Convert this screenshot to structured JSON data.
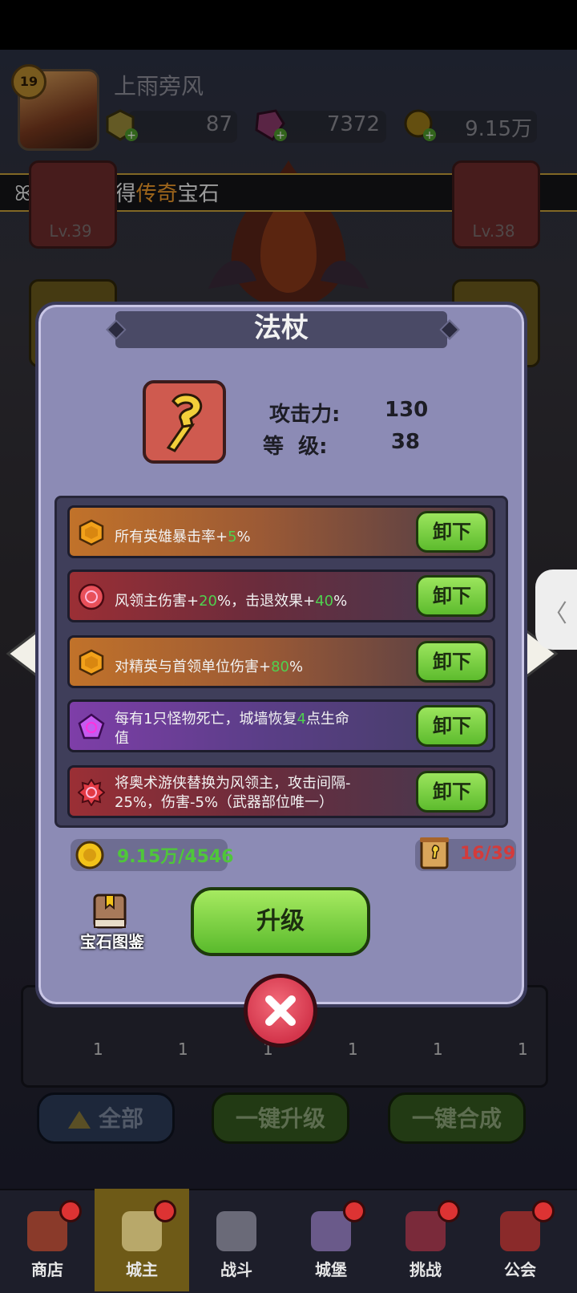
{
  "player": {
    "name": "上雨旁风",
    "level": "19",
    "resource_1": "87",
    "resource_2": "7372",
    "resource_3": "9.15万"
  },
  "banner": {
    "prefix": "宝箱中获得",
    "highlight": "传奇",
    "suffix": "宝石",
    "lead_glyph": "ꕤ"
  },
  "side_slots": {
    "left_level": "Lv.39",
    "right_level": "Lv.38"
  },
  "modal": {
    "title": "法杖",
    "stats": {
      "attack_label": "攻击力:",
      "attack_value": "130",
      "level_label": "等  级:",
      "level_value": "38"
    },
    "gems": [
      {
        "pre": "所有英雄暴击率+",
        "v1": "5",
        "mid": "%",
        "v2": "",
        "post": "",
        "line2": "",
        "kind": "orange",
        "button": "卸下"
      },
      {
        "pre": "风领主伤害+",
        "v1": "20",
        "mid": "%，击退效果+",
        "v2": "40",
        "post": "%",
        "line2": "",
        "kind": "red",
        "button": "卸下"
      },
      {
        "pre": "对精英与首领单位伤害+",
        "v1": "80",
        "mid": "%",
        "v2": "",
        "post": "",
        "line2": "",
        "kind": "orange",
        "button": "卸下"
      },
      {
        "pre": "每有1只怪物死亡，城墙恢复",
        "v1": "4",
        "mid": "点生命",
        "v2": "",
        "post": "",
        "line2": "值",
        "kind": "purple",
        "button": "卸下"
      },
      {
        "pre": "将奥术游侠替换为风领主，攻击间隔-",
        "v1": "",
        "mid": "",
        "v2": "",
        "post": "",
        "line2": "25%，伤害-5%（武器部位唯一）",
        "kind": "red",
        "button": "卸下"
      }
    ],
    "gold": "9.15万/4546",
    "scrolls": "16/39",
    "codex_label": "宝石图鉴",
    "upgrade_label": "升级"
  },
  "bottom_buttons": {
    "all": "全部",
    "one_key_upgrade": "一键升级",
    "one_key_merge": "一键合成"
  },
  "inventory_counts": [
    "1",
    "1",
    "1",
    "1",
    "1",
    "1"
  ],
  "nav": [
    "商店",
    "城主",
    "战斗",
    "城堡",
    "挑战",
    "公会"
  ],
  "colors": {
    "accent_green": "#5aba2c",
    "value_green": "#4fd14f",
    "highlight_orange": "#f29b2a",
    "close_red": "#d3354b",
    "modal_bg": "#8c8bb5"
  }
}
